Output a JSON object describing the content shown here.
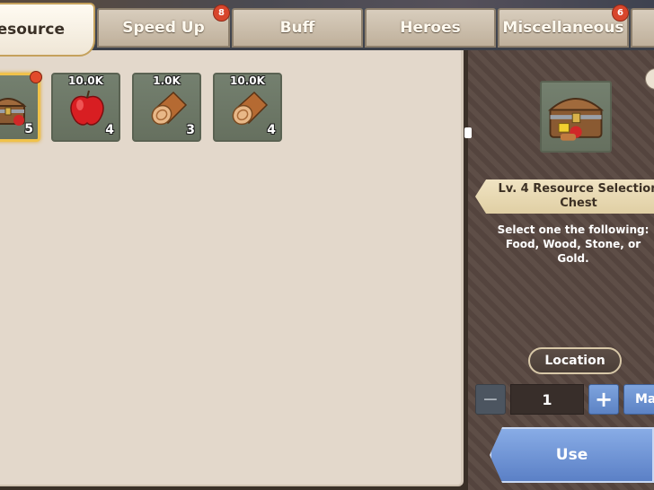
{
  "tabs": [
    {
      "label": "Resource",
      "active": true,
      "badge": null
    },
    {
      "label": "Speed Up",
      "active": false,
      "badge": "8"
    },
    {
      "label": "Buff",
      "active": false,
      "badge": null
    },
    {
      "label": "Heroes",
      "active": false,
      "badge": null
    },
    {
      "label": "Miscellaneous",
      "active": false,
      "badge": "6"
    }
  ],
  "items": [
    {
      "icon": "resource-chest-icon",
      "top_label": "",
      "count": "5",
      "selected": true,
      "has_alert": true
    },
    {
      "icon": "apple-icon",
      "top_label": "10.0K",
      "count": "4",
      "selected": false,
      "has_alert": false
    },
    {
      "icon": "wood-log-icon",
      "top_label": "1.0K",
      "count": "3",
      "selected": false,
      "has_alert": false
    },
    {
      "icon": "wood-log-icon",
      "top_label": "10.0K",
      "count": "4",
      "selected": false,
      "has_alert": false
    }
  ],
  "detail": {
    "icon": "resource-chest-icon",
    "title": "Lv. 4 Resource Selection Chest",
    "description": "Select one the following: Food, Wood, Stone, or Gold.",
    "location_label": "Location",
    "quantity": "1",
    "minus_label": "−",
    "plus_label": "+",
    "max_label": "Max",
    "use_label": "Use"
  },
  "colors": {
    "selected_border": "#f0c24a",
    "alert_red": "#e14a2a",
    "button_blue": "#5c82c4"
  }
}
